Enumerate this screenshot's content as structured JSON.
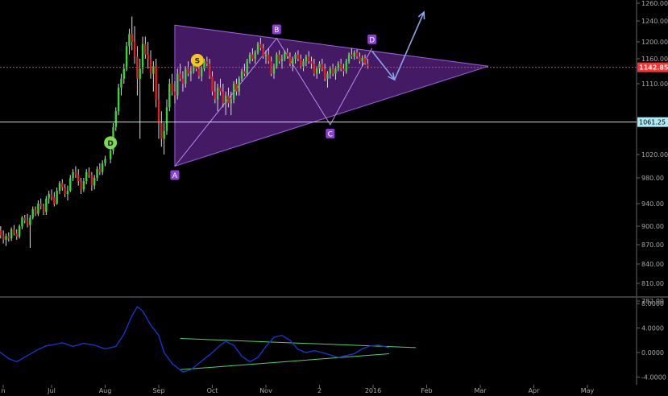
{
  "chart_data": {
    "type": "candlestick",
    "price_axis": {
      "ticks": [
        "1260.00",
        "1240.00",
        "1200.00",
        "1160.00",
        "1110.00",
        "1020.00",
        "980.00",
        "940.00",
        "900.00",
        "870.00",
        "840.00",
        "810.00",
        "782.00"
      ],
      "tick_values": [
        1260,
        1240,
        1200,
        1160,
        1110,
        1020,
        980,
        940,
        900,
        870,
        840,
        810,
        782
      ]
    },
    "indicator_axis": {
      "ticks": [
        "8.0000",
        "4.0000",
        "0.0000",
        "-4.0000"
      ],
      "tick_values": [
        8,
        4,
        0,
        -4
      ]
    },
    "x_axis": {
      "ticks": [
        "n",
        "Jul",
        "Aug",
        "Sep",
        "Oct",
        "Nov",
        "2",
        "2016",
        "Feb",
        "Mar",
        "Apr",
        "May"
      ],
      "tick_months": [
        -0.1,
        1,
        2,
        3,
        4,
        5,
        6,
        7,
        8,
        9,
        10,
        11
      ]
    },
    "levels": {
      "current_price": {
        "label": "1142.85",
        "value": 1142.85,
        "color": "#ff3030"
      },
      "support": {
        "label": "1061.25",
        "value": 1061.25,
        "color": "#aeeaf5"
      }
    },
    "pattern": {
      "fill": "#7b2fb8",
      "points": [
        {
          "label": "A",
          "month": 3.3,
          "price": 1000
        },
        {
          "label": "B",
          "month": 5.2,
          "price": 1207
        },
        {
          "label": "C",
          "month": 6.2,
          "price": 1058
        },
        {
          "label": "D",
          "month": 6.98,
          "price": 1185
        }
      ],
      "triangle": [
        {
          "month": 3.3,
          "price": 1232
        },
        {
          "month": 9.15,
          "price": 1145
        },
        {
          "month": 3.3,
          "price": 1000
        }
      ]
    },
    "markers": [
      {
        "label": "D",
        "month": 2.1,
        "price": 1035,
        "color": "#7ed957"
      },
      {
        "label": "S",
        "month": 3.72,
        "price": 1157,
        "color": "#f5c518"
      }
    ],
    "projection_arrows": [
      {
        "from_month": 6.98,
        "from_price": 1178,
        "to_month": 7.4,
        "to_price": 1118
      },
      {
        "from_month": 7.4,
        "from_price": 1118,
        "to_month": 7.95,
        "to_price": 1250
      }
    ],
    "indicator_lines": [
      {
        "from_month": 3.4,
        "from_value": 2.3,
        "to_month": 7.8,
        "to_value": 0.8
      },
      {
        "from_month": 3.4,
        "from_value": -2.8,
        "to_month": 7.3,
        "to_value": -0.2
      }
    ],
    "indicator_series_color": "#1a33cc",
    "indicator_series": [
      [
        -0.1,
        1.0
      ],
      [
        0.05,
        0.0
      ],
      [
        0.2,
        -1.0
      ],
      [
        0.35,
        -1.5
      ],
      [
        0.55,
        -0.5
      ],
      [
        0.75,
        0.5
      ],
      [
        0.9,
        1.1
      ],
      [
        1.05,
        1.3
      ],
      [
        1.2,
        1.6
      ],
      [
        1.4,
        1.0
      ],
      [
        1.6,
        1.5
      ],
      [
        1.8,
        1.2
      ],
      [
        2.0,
        0.6
      ],
      [
        2.2,
        1.0
      ],
      [
        2.35,
        3.0
      ],
      [
        2.5,
        6.0
      ],
      [
        2.6,
        7.5
      ],
      [
        2.7,
        6.8
      ],
      [
        2.85,
        4.5
      ],
      [
        3.0,
        2.8
      ],
      [
        3.1,
        0.0
      ],
      [
        3.25,
        -1.8
      ],
      [
        3.45,
        -3.2
      ],
      [
        3.6,
        -2.8
      ],
      [
        3.8,
        -1.4
      ],
      [
        4.0,
        0.0
      ],
      [
        4.15,
        1.2
      ],
      [
        4.25,
        1.8
      ],
      [
        4.4,
        1.2
      ],
      [
        4.55,
        -0.6
      ],
      [
        4.7,
        -1.5
      ],
      [
        4.85,
        -0.8
      ],
      [
        5.0,
        1.0
      ],
      [
        5.15,
        2.5
      ],
      [
        5.3,
        2.8
      ],
      [
        5.45,
        2.0
      ],
      [
        5.6,
        0.5
      ],
      [
        5.75,
        0.0
      ],
      [
        5.9,
        0.3
      ],
      [
        6.05,
        0.0
      ],
      [
        6.2,
        -0.4
      ],
      [
        6.35,
        -0.8
      ],
      [
        6.5,
        -0.5
      ],
      [
        6.65,
        -0.2
      ],
      [
        6.8,
        0.6
      ],
      [
        6.95,
        1.1
      ],
      [
        7.1,
        1.2
      ],
      [
        7.3,
        0.8
      ]
    ],
    "candles": [
      [
        -0.1,
        880,
        892,
        875,
        890
      ],
      [
        -0.05,
        890,
        895,
        870,
        875
      ],
      [
        0.0,
        875,
        898,
        868,
        893
      ],
      [
        0.05,
        893,
        900,
        880,
        885
      ],
      [
        0.1,
        885,
        893,
        872,
        878
      ],
      [
        0.15,
        878,
        888,
        868,
        884
      ],
      [
        0.2,
        884,
        890,
        875,
        880
      ],
      [
        0.25,
        880,
        898,
        876,
        895
      ],
      [
        0.3,
        895,
        902,
        885,
        888
      ],
      [
        0.35,
        888,
        895,
        878,
        883
      ],
      [
        0.4,
        883,
        903,
        880,
        900
      ],
      [
        0.45,
        900,
        918,
        895,
        915
      ],
      [
        0.5,
        915,
        920,
        905,
        910
      ],
      [
        0.55,
        910,
        922,
        898,
        902
      ],
      [
        0.6,
        902,
        920,
        865,
        915
      ],
      [
        0.65,
        915,
        935,
        912,
        930
      ],
      [
        0.7,
        930,
        935,
        918,
        922
      ],
      [
        0.75,
        922,
        945,
        918,
        940
      ],
      [
        0.8,
        940,
        948,
        930,
        935
      ],
      [
        0.85,
        935,
        940,
        920,
        925
      ],
      [
        0.9,
        925,
        952,
        920,
        948
      ],
      [
        0.95,
        948,
        960,
        940,
        955
      ],
      [
        1.0,
        955,
        962,
        945,
        950
      ],
      [
        1.05,
        950,
        958,
        935,
        940
      ],
      [
        1.1,
        940,
        965,
        938,
        960
      ],
      [
        1.15,
        960,
        975,
        955,
        972
      ],
      [
        1.2,
        972,
        978,
        960,
        965
      ],
      [
        1.25,
        965,
        970,
        950,
        955
      ],
      [
        1.3,
        955,
        968,
        945,
        960
      ],
      [
        1.35,
        960,
        985,
        958,
        980
      ],
      [
        1.4,
        980,
        995,
        975,
        990
      ],
      [
        1.45,
        990,
        1000,
        980,
        985
      ],
      [
        1.5,
        985,
        995,
        968,
        975
      ],
      [
        1.55,
        975,
        980,
        955,
        962
      ],
      [
        1.6,
        962,
        980,
        958,
        975
      ],
      [
        1.65,
        975,
        995,
        970,
        990
      ],
      [
        1.7,
        990,
        998,
        980,
        985
      ],
      [
        1.75,
        985,
        990,
        960,
        968
      ],
      [
        1.8,
        968,
        985,
        962,
        980
      ],
      [
        1.85,
        980,
        1000,
        975,
        995
      ],
      [
        1.9,
        995,
        1005,
        985,
        990
      ],
      [
        1.95,
        990,
        1010,
        985,
        1005
      ],
      [
        2.0,
        1005,
        1018,
        1000,
        1012
      ],
      [
        2.1,
        1012,
        1030,
        1005,
        1025
      ],
      [
        2.15,
        1025,
        1060,
        1020,
        1055
      ],
      [
        2.2,
        1055,
        1080,
        1050,
        1075
      ],
      [
        2.25,
        1075,
        1110,
        1070,
        1105
      ],
      [
        2.3,
        1105,
        1130,
        1095,
        1120
      ],
      [
        2.35,
        1120,
        1150,
        1110,
        1140
      ],
      [
        2.4,
        1140,
        1200,
        1135,
        1190
      ],
      [
        2.45,
        1190,
        1225,
        1170,
        1215
      ],
      [
        2.5,
        1215,
        1245,
        1180,
        1200
      ],
      [
        2.55,
        1200,
        1230,
        1150,
        1165
      ],
      [
        2.6,
        1165,
        1190,
        1095,
        1120
      ],
      [
        2.65,
        1120,
        1160,
        1040,
        1140
      ],
      [
        2.7,
        1140,
        1210,
        1130,
        1195
      ],
      [
        2.75,
        1195,
        1210,
        1160,
        1170
      ],
      [
        2.8,
        1170,
        1200,
        1140,
        1160
      ],
      [
        2.85,
        1160,
        1180,
        1120,
        1130
      ],
      [
        2.9,
        1130,
        1155,
        1100,
        1145
      ],
      [
        2.95,
        1145,
        1160,
        1080,
        1090
      ],
      [
        3.0,
        1090,
        1110,
        1040,
        1060
      ],
      [
        3.05,
        1060,
        1075,
        1030,
        1040
      ],
      [
        3.1,
        1040,
        1060,
        1020,
        1050
      ],
      [
        3.15,
        1050,
        1090,
        1045,
        1080
      ],
      [
        3.2,
        1080,
        1120,
        1075,
        1110
      ],
      [
        3.25,
        1110,
        1130,
        1095,
        1100
      ],
      [
        3.3,
        1100,
        1115,
        1085,
        1095
      ],
      [
        3.35,
        1095,
        1140,
        1090,
        1130
      ],
      [
        3.4,
        1130,
        1150,
        1115,
        1120
      ],
      [
        3.45,
        1120,
        1135,
        1100,
        1110
      ],
      [
        3.5,
        1110,
        1145,
        1105,
        1140
      ],
      [
        3.55,
        1140,
        1155,
        1125,
        1130
      ],
      [
        3.6,
        1130,
        1145,
        1115,
        1135
      ],
      [
        3.65,
        1135,
        1160,
        1130,
        1150
      ],
      [
        3.7,
        1150,
        1165,
        1135,
        1140
      ],
      [
        3.75,
        1140,
        1150,
        1120,
        1125
      ],
      [
        3.8,
        1125,
        1145,
        1115,
        1140
      ],
      [
        3.85,
        1140,
        1160,
        1135,
        1155
      ],
      [
        3.9,
        1155,
        1165,
        1145,
        1150
      ],
      [
        3.95,
        1150,
        1160,
        1120,
        1125
      ],
      [
        4.0,
        1125,
        1135,
        1095,
        1100
      ],
      [
        4.05,
        1100,
        1115,
        1085,
        1090
      ],
      [
        4.1,
        1090,
        1110,
        1075,
        1105
      ],
      [
        4.15,
        1105,
        1120,
        1095,
        1100
      ],
      [
        4.2,
        1100,
        1110,
        1080,
        1085
      ],
      [
        4.25,
        1085,
        1100,
        1070,
        1095
      ],
      [
        4.3,
        1095,
        1105,
        1080,
        1085
      ],
      [
        4.35,
        1085,
        1100,
        1070,
        1090
      ],
      [
        4.4,
        1090,
        1115,
        1085,
        1110
      ],
      [
        4.45,
        1110,
        1120,
        1095,
        1100
      ],
      [
        4.5,
        1100,
        1125,
        1095,
        1120
      ],
      [
        4.55,
        1120,
        1140,
        1115,
        1135
      ],
      [
        4.6,
        1135,
        1150,
        1125,
        1130
      ],
      [
        4.65,
        1130,
        1160,
        1125,
        1155
      ],
      [
        4.7,
        1155,
        1175,
        1150,
        1170
      ],
      [
        4.75,
        1170,
        1185,
        1155,
        1160
      ],
      [
        4.8,
        1160,
        1180,
        1150,
        1175
      ],
      [
        4.85,
        1175,
        1200,
        1170,
        1195
      ],
      [
        4.9,
        1195,
        1208,
        1180,
        1185
      ],
      [
        4.95,
        1185,
        1195,
        1160,
        1165
      ],
      [
        5.0,
        1165,
        1180,
        1150,
        1170
      ],
      [
        5.05,
        1170,
        1185,
        1150,
        1155
      ],
      [
        5.1,
        1155,
        1165,
        1125,
        1130
      ],
      [
        5.15,
        1130,
        1150,
        1120,
        1145
      ],
      [
        5.2,
        1145,
        1175,
        1140,
        1170
      ],
      [
        5.25,
        1170,
        1180,
        1150,
        1155
      ],
      [
        5.3,
        1155,
        1170,
        1140,
        1160
      ],
      [
        5.35,
        1160,
        1180,
        1155,
        1175
      ],
      [
        5.4,
        1175,
        1185,
        1160,
        1165
      ],
      [
        5.45,
        1165,
        1175,
        1145,
        1150
      ],
      [
        5.5,
        1150,
        1165,
        1135,
        1160
      ],
      [
        5.55,
        1160,
        1175,
        1150,
        1170
      ],
      [
        5.6,
        1170,
        1180,
        1155,
        1160
      ],
      [
        5.65,
        1160,
        1170,
        1140,
        1145
      ],
      [
        5.7,
        1145,
        1160,
        1135,
        1155
      ],
      [
        5.75,
        1155,
        1170,
        1145,
        1165
      ],
      [
        5.8,
        1165,
        1178,
        1150,
        1155
      ],
      [
        5.85,
        1155,
        1165,
        1140,
        1150
      ],
      [
        5.9,
        1150,
        1160,
        1125,
        1130
      ],
      [
        5.95,
        1130,
        1145,
        1120,
        1140
      ],
      [
        6.0,
        1140,
        1155,
        1130,
        1150
      ],
      [
        6.05,
        1150,
        1160,
        1135,
        1140
      ],
      [
        6.1,
        1140,
        1150,
        1115,
        1120
      ],
      [
        6.15,
        1120,
        1135,
        1105,
        1130
      ],
      [
        6.2,
        1130,
        1145,
        1120,
        1140
      ],
      [
        6.25,
        1140,
        1150,
        1125,
        1130
      ],
      [
        6.3,
        1130,
        1145,
        1118,
        1140
      ],
      [
        6.35,
        1140,
        1155,
        1135,
        1150
      ],
      [
        6.4,
        1150,
        1160,
        1135,
        1140
      ],
      [
        6.45,
        1140,
        1150,
        1125,
        1135
      ],
      [
        6.5,
        1135,
        1160,
        1130,
        1155
      ],
      [
        6.55,
        1155,
        1175,
        1150,
        1170
      ],
      [
        6.6,
        1170,
        1185,
        1160,
        1165
      ],
      [
        6.65,
        1165,
        1180,
        1158,
        1175
      ],
      [
        6.7,
        1175,
        1182,
        1160,
        1165
      ],
      [
        6.75,
        1165,
        1175,
        1150,
        1155
      ],
      [
        6.8,
        1155,
        1168,
        1145,
        1162
      ],
      [
        6.85,
        1162,
        1170,
        1148,
        1150
      ],
      [
        6.9,
        1150,
        1160,
        1140,
        1145
      ]
    ]
  }
}
